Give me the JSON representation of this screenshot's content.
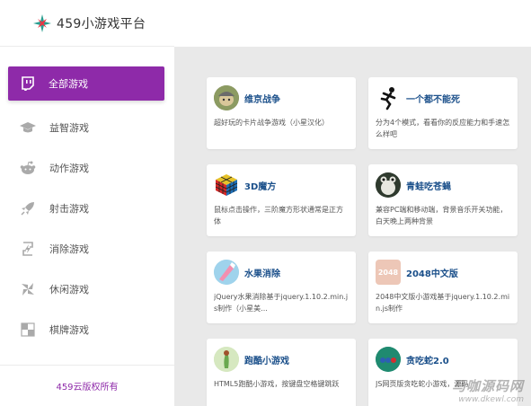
{
  "brand": {
    "title": "459小游戏平台"
  },
  "nav": [
    {
      "label": "全部游戏",
      "icon": "twitch-icon",
      "active": true
    },
    {
      "label": "益智游戏",
      "icon": "graduation-cap-icon",
      "active": false
    },
    {
      "label": "动作游戏",
      "icon": "reddit-alien-icon",
      "active": false
    },
    {
      "label": "射击游戏",
      "icon": "rocket-icon",
      "active": false
    },
    {
      "label": "消除游戏",
      "icon": "lightning-box-icon",
      "active": false
    },
    {
      "label": "休闲游戏",
      "icon": "pinwheel-icon",
      "active": false
    },
    {
      "label": "棋牌游戏",
      "icon": "chessboard-icon",
      "active": false
    }
  ],
  "footer": {
    "text": "459云版权所有"
  },
  "games": [
    {
      "title": "维京战争",
      "desc": "超好玩的卡片战争游戏（小星汉化）",
      "icon": "viking-icon"
    },
    {
      "title": "一个都不能死",
      "desc": "分为4个模式，看看你的反应能力和手速怎么样吧",
      "icon": "running-stickman-icon"
    },
    {
      "title": "3D魔方",
      "desc": "鼠标点击操作，三阶魔方形状通常是正方体",
      "icon": "rubiks-cube-icon"
    },
    {
      "title": "青蛙吃苍蝇",
      "desc": "兼容PC端和移动端，背景音乐开关功能，白天晚上两种背景",
      "icon": "frog-icon"
    },
    {
      "title": "水果消除",
      "desc": "jQuery水果消除基于jquery.1.10.2.min.js制作（小星美...",
      "icon": "fruit-icon"
    },
    {
      "title": "2048中文版",
      "desc": "2048中文版小游戏基于jquery.1.10.2.min.js制作",
      "icon": "2048-icon",
      "badge": "2048"
    },
    {
      "title": "跑酷小游戏",
      "desc": "HTML5跑酷小游戏，按键盘空格键跳跃",
      "icon": "parkour-icon"
    },
    {
      "title": "贪吃蛇2.0",
      "desc": "JS网页版贪吃蛇小游戏，源码",
      "icon": "snake-icon"
    }
  ],
  "watermark": {
    "line1": "马咖源码网",
    "line2": "www.dkewl.com"
  },
  "colors": {
    "accent": "#8e2aa9",
    "title_link": "#1a4f8a"
  }
}
